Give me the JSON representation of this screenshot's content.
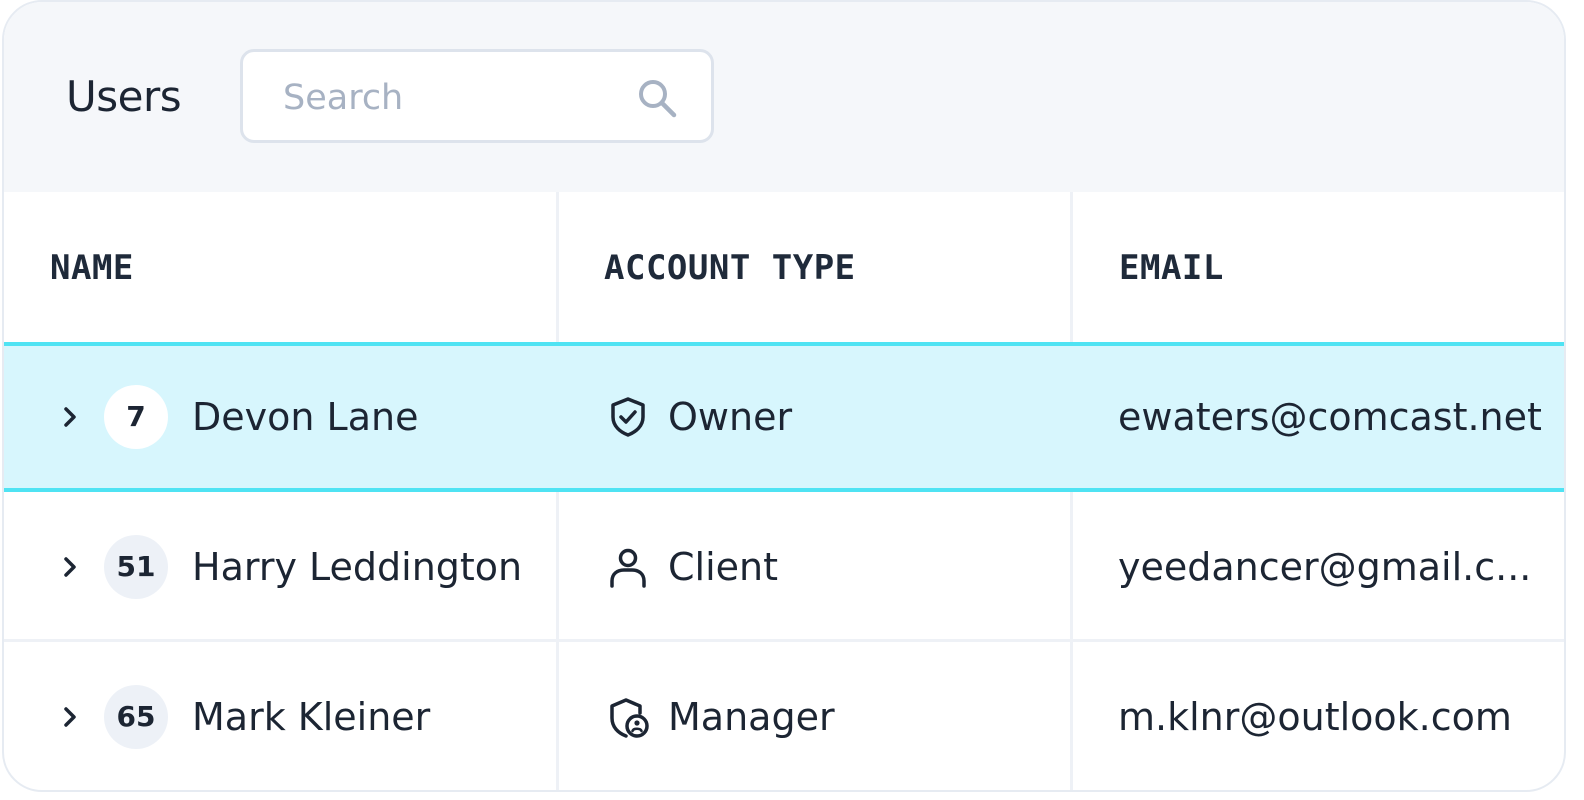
{
  "header": {
    "title": "Users",
    "search": {
      "placeholder": "Search",
      "icon": "search-icon"
    }
  },
  "table": {
    "columns": [
      "NAME",
      "ACCOUNT TYPE",
      "EMAIL"
    ],
    "rows": [
      {
        "count": "7",
        "name": "Devon Lane",
        "account_type": "Owner",
        "account_icon": "shield-check-icon",
        "email": "ewaters@comcast.net",
        "selected": true
      },
      {
        "count": "51",
        "name": "Harry Leddington",
        "account_type": "Client",
        "account_icon": "user-icon",
        "email": "yeedancer@gmail.c...",
        "selected": false
      },
      {
        "count": "65",
        "name": "Mark Kleiner",
        "account_type": "Manager",
        "account_icon": "shield-user-icon",
        "email": "m.klnr@outlook.com",
        "selected": false
      }
    ]
  },
  "colors": {
    "selected_row_bg": "#d7f6fd",
    "selected_row_border": "#4fe3f3",
    "header_bg": "#f5f7fa",
    "text": "#1c2533"
  }
}
